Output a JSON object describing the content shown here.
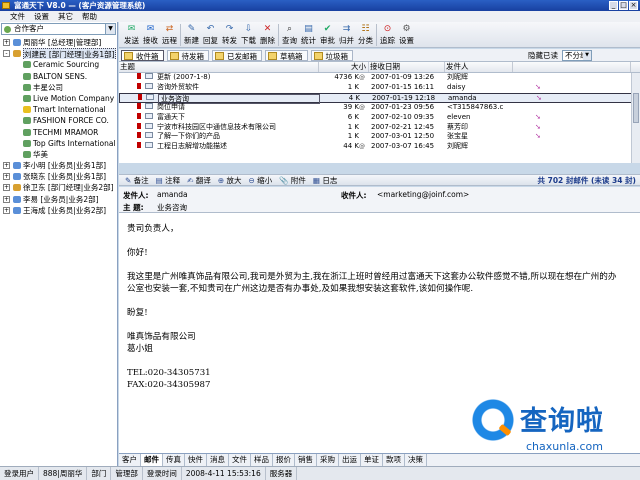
{
  "window": {
    "title": "富通天下  V8.0 — (客户资源管理系统)"
  },
  "menu": [
    "文件",
    "设置",
    "其它",
    "帮助"
  ],
  "left": {
    "combo": "合作客户",
    "tree": [
      {
        "label": "周丽华 [总经理|管理部]",
        "level": 0,
        "pm": "+",
        "color": "#5a8fd8"
      },
      {
        "label": "刘建民 [部门经理|业务1部]",
        "level": 0,
        "pm": "-",
        "color": "#d8a030",
        "selected": true
      },
      {
        "label": "Ceramic Sourcing",
        "level": 1,
        "color": "#60a060"
      },
      {
        "label": "BALTON SENS.",
        "level": 1,
        "color": "#60a060"
      },
      {
        "label": "丰星公司",
        "level": 1,
        "color": "#60a060"
      },
      {
        "label": "Live Motion Company",
        "level": 1,
        "color": "#60a060"
      },
      {
        "label": "Tmart International",
        "level": 1,
        "color": "#e8c020"
      },
      {
        "label": "FASHION FORCE CO.",
        "level": 1,
        "color": "#60a060"
      },
      {
        "label": "TECHMI MRAMOR",
        "level": 1,
        "color": "#60a060"
      },
      {
        "label": "Top Gifts International",
        "level": 1,
        "color": "#60a060"
      },
      {
        "label": "华美",
        "level": 1,
        "color": "#60a060"
      },
      {
        "label": "李小明 [业务员|业务1部]",
        "level": 0,
        "pm": "+",
        "color": "#5a8fd8"
      },
      {
        "label": "张晓东 [业务员|业务1部]",
        "level": 0,
        "pm": "+",
        "color": "#5a8fd8"
      },
      {
        "label": "徐卫东 [部门经理|业务2部]",
        "level": 0,
        "pm": "+",
        "color": "#d8a030"
      },
      {
        "label": "李易 [业务员|业务2部]",
        "level": 0,
        "pm": "+",
        "color": "#5a8fd8"
      },
      {
        "label": "王海成 [业务员|业务2部]",
        "level": 0,
        "pm": "+",
        "color": "#5a8fd8"
      }
    ]
  },
  "toolbar": [
    {
      "label": "发送",
      "icon": "send-icon",
      "glyph": "✉",
      "color": "#2a6"
    },
    {
      "label": "接收",
      "icon": "receive-icon",
      "glyph": "✉",
      "color": "#26c"
    },
    {
      "label": "远程",
      "icon": "remote-icon",
      "glyph": "⇄",
      "color": "#c62"
    },
    {
      "label": "新建",
      "icon": "new-icon",
      "glyph": "✎",
      "color": "#36a"
    },
    {
      "label": "回复",
      "icon": "reply-icon",
      "glyph": "↶",
      "color": "#36a"
    },
    {
      "label": "转发",
      "icon": "forward-icon",
      "glyph": "↷",
      "color": "#36a"
    },
    {
      "label": "下载",
      "icon": "download-icon",
      "glyph": "⇩",
      "color": "#36a"
    },
    {
      "label": "删除",
      "icon": "delete-icon",
      "glyph": "✕",
      "color": "#c22"
    },
    {
      "label": "查询",
      "icon": "search-icon",
      "glyph": "⌕",
      "color": "#333"
    },
    {
      "label": "统计",
      "icon": "statistics-icon",
      "glyph": "▤",
      "color": "#36a"
    },
    {
      "label": "审批",
      "icon": "approve-icon",
      "glyph": "✔",
      "color": "#2a6"
    },
    {
      "label": "归并",
      "icon": "merge-icon",
      "glyph": "⇉",
      "color": "#36a"
    },
    {
      "label": "分类",
      "icon": "classify-icon",
      "glyph": "☷",
      "color": "#a60"
    },
    {
      "label": "追踪",
      "icon": "track-icon",
      "glyph": "⊙",
      "color": "#c22"
    },
    {
      "label": "设置",
      "icon": "settings-icon",
      "glyph": "⚙",
      "color": "#555"
    }
  ],
  "folders": [
    {
      "label": "收件箱",
      "active": true
    },
    {
      "label": "待发箱"
    },
    {
      "label": "已发邮箱"
    },
    {
      "label": "草稿箱"
    },
    {
      "label": "垃圾箱"
    }
  ],
  "filter": {
    "label": "隐藏已读",
    "value": "不分组"
  },
  "grid": {
    "columns": [
      "主题",
      "大小",
      "接收日期",
      "发件人"
    ],
    "rows": [
      {
        "subject": "更新 (2007-1-8)",
        "size": "4736 K",
        "date": "2007-01-09 13:26",
        "sender": "刘昵辉",
        "clip": true,
        "pink": false
      },
      {
        "subject": "咨询外贸软件",
        "size": "1 K",
        "date": "2007-01-15 16:11",
        "sender": "daisy",
        "clip": false,
        "pink": true
      },
      {
        "subject": "业务咨询",
        "size": "4 K",
        "date": "2007-01-19 12:18",
        "sender": "amanda",
        "clip": false,
        "pink": true,
        "selected": true
      },
      {
        "subject": "岗位申请",
        "size": "39 K",
        "date": "2007-01-23 09:56",
        "sender": "<T315847863.c",
        "clip": true,
        "pink": false
      },
      {
        "subject": "富通天下",
        "size": "6 K",
        "date": "2007-02-10 09:35",
        "sender": "eleven",
        "clip": false,
        "pink": true
      },
      {
        "subject": "宁波市科技园区中通信息技术有限公司",
        "size": "1 K",
        "date": "2007-02-21 12:45",
        "sender": "蔡芳印",
        "clip": false,
        "pink": true
      },
      {
        "subject": "了解一下你们的产品",
        "size": "1 K",
        "date": "2007-03-01 12:50",
        "sender": "张宝星",
        "clip": false,
        "pink": true
      },
      {
        "subject": "工程日志解增功能描述",
        "size": "44 K",
        "date": "2007-03-07 16:45",
        "sender": "刘昵辉",
        "clip": true,
        "pink": false
      }
    ]
  },
  "msgtoolbar": {
    "items": [
      "备注",
      "注释",
      "翻译",
      "放大",
      "缩小",
      "附件",
      "日志"
    ],
    "count": "共 702 封邮件 (未读 34 封)"
  },
  "message": {
    "from_label": "发件人:",
    "from": "amanda",
    "to_label": "收件人:",
    "to": "<marketing@joinf.com>",
    "subject_label": "主  题:",
    "subject": "业务咨询",
    "body": [
      "贵司负责人，",
      "",
      "   你好!",
      "",
      "     我这里是广州唯真饰品有限公司,我司是外贸为主,我在浙江上班时曾经用过富通天下这套办公软件感觉不错,所以现在想在广州的办公室也安装一套,不知贵司在广州这边是否有办事处,及如果我想安装这套软件,该如何操作呢.",
      "",
      "盼复!",
      "",
      "唯真饰品有限公司",
      "葛小姐",
      "",
      "TEL:020-34305731",
      "FAX:020-34305987"
    ]
  },
  "bottomtabs": [
    "客户",
    "邮件",
    "传真",
    "快件",
    "消息",
    "文件",
    "样品",
    "报价",
    "销售",
    "采购",
    "出运",
    "单证",
    "款项",
    "决策"
  ],
  "status": [
    "登录用户",
    "888|周丽华",
    "部门",
    "管理部",
    "登录时间",
    "2008-4-11 15:53:16",
    "服务器"
  ],
  "watermark": {
    "main": "查询啦",
    "sub": "chaxunla.com"
  }
}
